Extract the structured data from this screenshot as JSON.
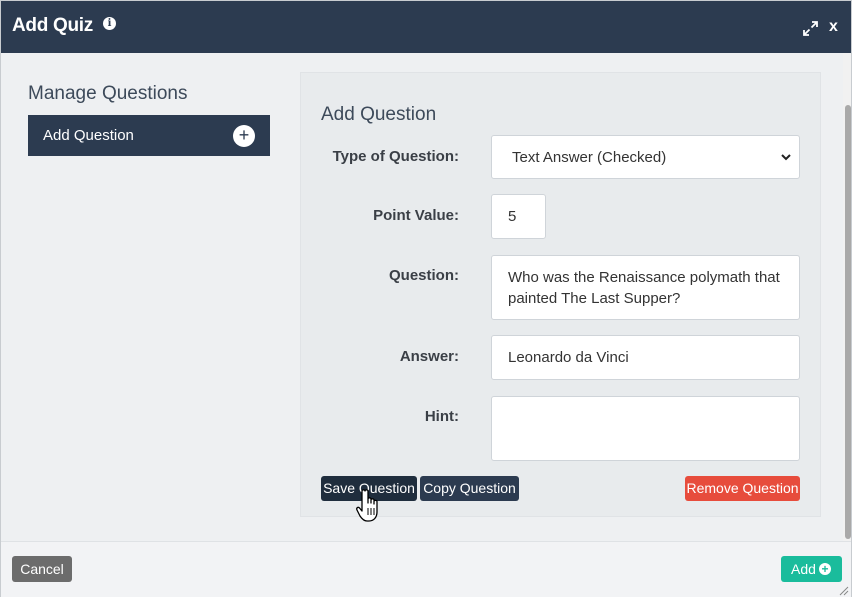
{
  "dialog": {
    "title": "Add Quiz",
    "icons": {
      "info": "info-icon",
      "expand": "expand-icon"
    },
    "close_label": "x"
  },
  "sidebar": {
    "heading": "Manage Questions",
    "items": [
      {
        "label": "Add Question",
        "icon": "plus-circle-icon"
      }
    ]
  },
  "form": {
    "heading": "Add Question",
    "type_label": "Type of Question:",
    "type_value": "Text Answer (Checked)",
    "point_label": "Point Value:",
    "point_value": "5",
    "question_label": "Question:",
    "question_value": "Who was the Renaissance polymath that painted The Last Supper?",
    "answer_label": "Answer:",
    "answer_value": "Leonardo da Vinci",
    "hint_label": "Hint:",
    "hint_value": "",
    "buttons": {
      "save": "Save Question",
      "copy": "Copy Question",
      "remove": "Remove Question"
    }
  },
  "footer": {
    "cancel": "Cancel",
    "add": "Add"
  },
  "colors": {
    "header_bg": "#2c3b50",
    "accent_teal": "#1abc9c",
    "danger_red": "#e74c3c"
  }
}
